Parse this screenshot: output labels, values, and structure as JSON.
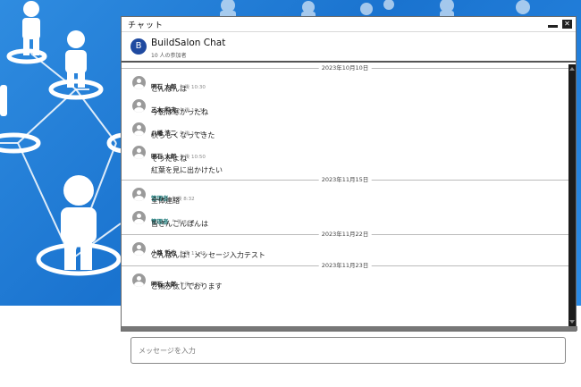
{
  "window": {
    "title": "チャット",
    "close_glyph": "✕"
  },
  "chat": {
    "avatar_letter": "B",
    "name": "BuildSalon Chat",
    "members": "10 人の参加者"
  },
  "dates": [
    "2023年10月10日",
    "2023年11月15日",
    "2023年11月22日",
    "2023年11月23日"
  ],
  "messages": [
    {
      "name": "明石 太郎",
      "time": "午後 10:30",
      "text": "こんばんは"
    },
    {
      "name": "三木 和夫",
      "time": "午後 10:35",
      "text": "今朝は寒かったね"
    },
    {
      "name": "八幡 浩二",
      "time": "午後 10:45",
      "text": "秋らしくなってきた"
    },
    {
      "name": "明石 太郎",
      "time": "午後 10:50",
      "text": "そうだよね",
      "text2": "紅葉を見に出かけたい"
    },
    {
      "name": "管理者",
      "time": "午後 8:32",
      "text": "全体連絡"
    },
    {
      "name": "管理者",
      "time": "午後 8:36",
      "text": "皆さんこんばんは"
    },
    {
      "name": "小路 哲也",
      "time": "午後 11:49",
      "text": "こんばんは！メッセージ入力テスト"
    },
    {
      "name": "明石 太郎",
      "time": "午後 9:12",
      "text": "ご無沙汰しております"
    }
  ],
  "composer": {
    "placeholder": "メッセージを入力"
  },
  "colors": {
    "background_blue": "#1a73cf",
    "admin_name": "#1f7a7a",
    "avatar_blue": "#1f4aa0"
  }
}
